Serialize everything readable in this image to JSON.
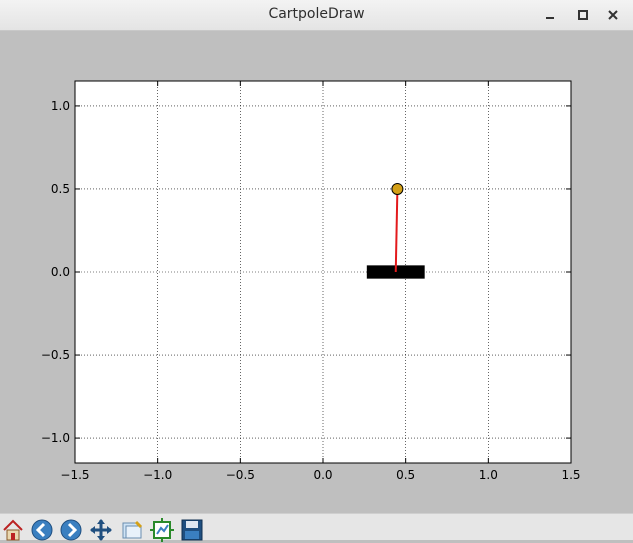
{
  "window": {
    "title": "CartpoleDraw"
  },
  "window_controls": {
    "minimize": "minimize-icon",
    "maximize": "maximize-icon",
    "close": "close-icon"
  },
  "chart_data": {
    "type": "scatter",
    "xlim": [
      -1.5,
      1.5
    ],
    "ylim": [
      -1.15,
      1.15
    ],
    "xticks": [
      -1.5,
      -1.0,
      -0.5,
      0.0,
      0.5,
      1.0,
      1.5
    ],
    "xtick_labels": [
      "−1.5",
      "−1.0",
      "−0.5",
      "0.0",
      "0.5",
      "1.0",
      "1.5"
    ],
    "yticks": [
      -1.0,
      -0.5,
      0.0,
      0.5,
      1.0
    ],
    "ytick_labels": [
      "−1.0",
      "−0.5",
      "0.0",
      "0.5",
      "1.0"
    ],
    "grid": true,
    "cart": {
      "center_x": 0.44,
      "center_y": 0.0,
      "width": 0.35,
      "height": 0.08,
      "color": "#000000"
    },
    "pole": {
      "x0": 0.44,
      "y0": 0.0,
      "x1": 0.45,
      "y1": 0.5,
      "color": "#e31a1c"
    },
    "bob": {
      "x": 0.45,
      "y": 0.5,
      "fill": "#d4a017",
      "edge": "#000000"
    }
  },
  "toolbar": {
    "buttons": [
      "home-icon",
      "back-icon",
      "forward-icon",
      "pan-icon",
      "zoom-icon",
      "subplots-icon",
      "save-icon"
    ]
  }
}
